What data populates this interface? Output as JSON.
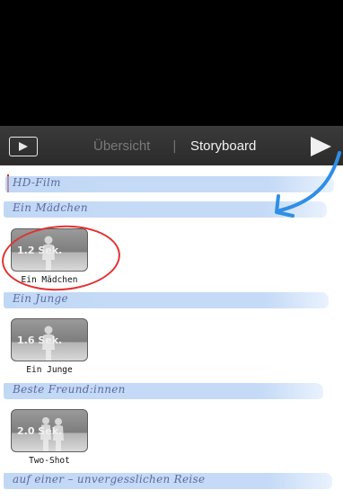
{
  "toolbar": {
    "play_icon": "play-in-box-icon",
    "overview_label": "Übersicht",
    "divider": "|",
    "storyboard_label": "Storyboard",
    "big_play_icon": "play-icon"
  },
  "storyboard": {
    "film_title": "HD-Film",
    "sections": [
      {
        "caption": "Ein Mädchen",
        "clip_duration": "1.2 Sek.",
        "clip_label": "Ein Mädchen"
      },
      {
        "caption": "Ein Junge",
        "clip_duration": "1.6 Sek.",
        "clip_label": "Ein Junge"
      },
      {
        "caption": "Beste Freund:innen",
        "clip_duration": "2.0 Sek.",
        "clip_label": "Two-Shot"
      }
    ],
    "last_caption": "auf einer – unvergesslichen Reise"
  },
  "colors": {
    "annotation_red": "#e23131",
    "arrow_blue": "#2f8ee6",
    "stroke_blue": "#b6d0f4"
  }
}
